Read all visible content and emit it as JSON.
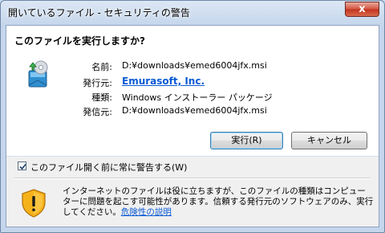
{
  "window": {
    "title": "開いているファイル - セキュリティの警告",
    "close_label": "x"
  },
  "dialog": {
    "question": "このファイルを実行しますか?",
    "fields": [
      {
        "label": "名前:",
        "value": "D:¥downloads¥emed6004jfx.msi"
      },
      {
        "label": "発行元:",
        "value": "Emurasoft, Inc."
      },
      {
        "label": "種類:",
        "value": "Windows インストーラー パッケージ"
      },
      {
        "label": "発信元:",
        "value": "D:¥downloads¥emed6004jfx.msi"
      }
    ],
    "buttons": {
      "run": "実行(R)",
      "cancel": "キャンセル"
    },
    "checkbox": {
      "label": "このファイル開く前に常に警告する(W)",
      "checked": true
    },
    "warning": {
      "text": "インターネットのファイルは役に立ちますが、このファイルの種類はコンピューターに問題を起こす可能性があります。信頼する発行元のソフトウェアのみ、実行してください。",
      "link": "危険性の説明"
    }
  },
  "colors": {
    "link": "#0b5ad3",
    "close_button": "#c2321d"
  },
  "icons": {
    "app": "installer-package-icon",
    "warning": "security-shield-warning-icon"
  }
}
